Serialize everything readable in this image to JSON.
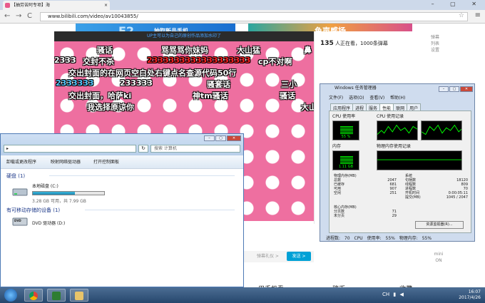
{
  "browser": {
    "tab_title": "【抽劳苦阿专项】海",
    "tab_close": "×",
    "window_controls": "– ▢ ✕",
    "back": "←",
    "forward": "→",
    "refresh": "C",
    "url": "www.bilibili.com/video/av10043855/",
    "star": "☆",
    "menu": "≡"
  },
  "page": {
    "banner_left_big": "E2",
    "banner_left_text": "抽取新品手机",
    "banner_right_text": "鱼声感扬",
    "player_notice": "UP主可以为自己的原创作品添加水印了",
    "danmaku": [
      "骚话",
      "骂骂骂你妹妈",
      "大山猛",
      "鼻",
      "交封不杀",
      "2333333333333333333",
      "cp不对啊",
      "2333",
      "交出封面的在网页空白处右键点名查源代码50行",
      "2333333",
      "233333",
      "骚套话",
      "三小",
      "交出封面，哈萨ki",
      "神tm骚话",
      "骚话",
      "我选择原谅你",
      "大山"
    ],
    "viewers_count": "135",
    "viewers_text": "人正在看，1000条弹幕",
    "side_buttons": [
      "弹幕",
      "列表",
      "设置"
    ],
    "danmaku_placeholder": "弹幕礼仪 >",
    "send_button": "发送 >",
    "mini_label": "mini",
    "mini_state": "ON",
    "bottom_links": [
      "用手机看",
      "稿币",
      "收藏"
    ]
  },
  "task_manager": {
    "title": "Windows 任务管理器",
    "menu": [
      "文件(F)",
      "选项(O)",
      "查看(V)",
      "帮助(H)"
    ],
    "tabs": [
      "应用程序",
      "进程",
      "服务",
      "性能",
      "联网",
      "用户"
    ],
    "active_tab": "性能",
    "cpu_usage_label": "CPU 使用率",
    "cpu_usage_value": "55 %",
    "cpu_usage_fraction": 0.55,
    "cpu_history_label": "CPU 使用记录",
    "memory_label": "内存",
    "memory_value": "1.11 GB",
    "memory_fraction": 0.55,
    "memory_history_label": "物理内存使用记录",
    "physical_memory_title": "物理内存(MB)",
    "physical_memory": [
      {
        "label": "总数",
        "value": "2047"
      },
      {
        "label": "已缓存",
        "value": "681"
      },
      {
        "label": "可用",
        "value": "907"
      },
      {
        "label": "空闲",
        "value": "251"
      }
    ],
    "kernel_memory_title": "核心内存(MB)",
    "kernel_memory": [
      {
        "label": "分页数",
        "value": "71"
      },
      {
        "label": "未分页",
        "value": "29"
      }
    ],
    "system_title": "系统",
    "system": [
      {
        "label": "句柄数",
        "value": "18120"
      },
      {
        "label": "线程数",
        "value": "809"
      },
      {
        "label": "进程数",
        "value": "70"
      },
      {
        "label": "开机时间",
        "value": "0:00:05:11"
      },
      {
        "label": "提交(MB)",
        "value": "1045 / 2047"
      }
    ],
    "resource_button": "资源监视器(R)...",
    "status": [
      "进程数: 70",
      "CPU 使用率: 55%",
      "物理内存: 55%"
    ],
    "win_min": "–",
    "win_max": "▢",
    "win_close": "✕"
  },
  "explorer": {
    "path_arrow": "▸",
    "refresh": "↻",
    "search_placeholder": "搜索 计算机",
    "toolbar": [
      "卸载或更改程序",
      "映射网络驱动器",
      "打开控制面板"
    ],
    "section_hdd": "硬盘 (1)",
    "drive_c_name": "本地磁盘 (C:)",
    "drive_c_space": "3.28 GB 可用，共 7.99 GB",
    "drive_c_used_fraction": 0.59,
    "section_removable": "有可移动存储的设备 (1)",
    "drive_d_name": "DVD 驱动器 (D:)",
    "dvd_label": "DVD",
    "win_min": "–",
    "win_max": "▢",
    "win_close": "✕"
  },
  "taskbar": {
    "tray_lang": "CH",
    "time": "16:07",
    "date": "2017/4/26"
  },
  "colors": {
    "accent": "#00a1d6",
    "player_pink": "#ee6fa0",
    "meter_green": "#00ff00"
  }
}
